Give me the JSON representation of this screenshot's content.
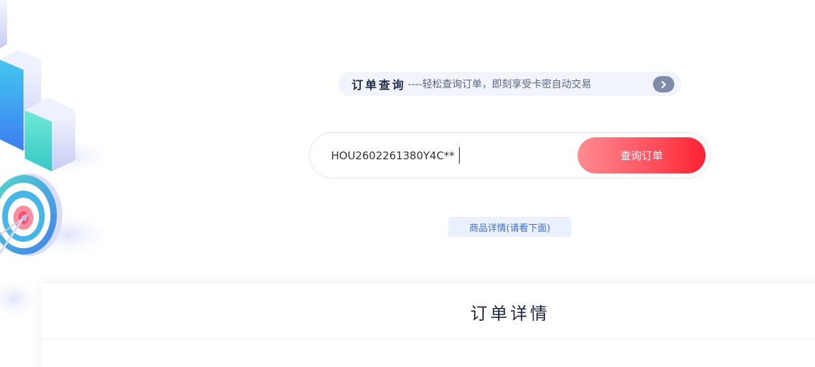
{
  "header": {
    "title": "订单查询",
    "subtitle": "----轻松查询订单，即刻享受卡密自动交易",
    "arrow_icon": "chevron-right-icon"
  },
  "search": {
    "value": "HOU2602261380Y4C**",
    "button_label": "查询订单"
  },
  "product_detail": {
    "label": "商品详情(请看下面)"
  },
  "order_detail": {
    "title": "订单详情"
  },
  "colors": {
    "accent_red": "#ff2233",
    "accent_pink": "#ff8a8f",
    "pill_bg": "#f1f4fa",
    "tag_bg": "#eaf0fd",
    "tag_text": "#3f6fc9"
  }
}
